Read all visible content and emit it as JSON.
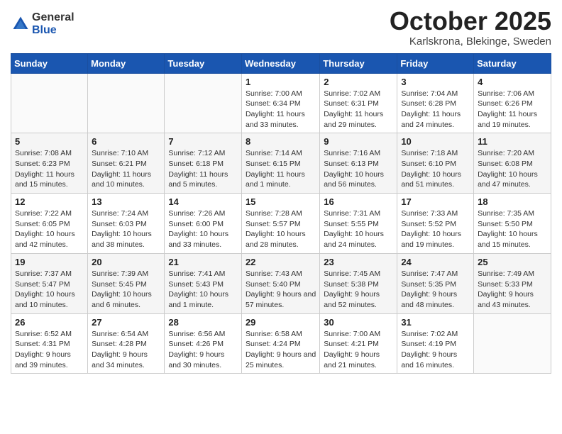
{
  "header": {
    "logo_general": "General",
    "logo_blue": "Blue",
    "month_title": "October 2025",
    "location": "Karlskrona, Blekinge, Sweden"
  },
  "days_of_week": [
    "Sunday",
    "Monday",
    "Tuesday",
    "Wednesday",
    "Thursday",
    "Friday",
    "Saturday"
  ],
  "weeks": [
    [
      {
        "day": "",
        "info": ""
      },
      {
        "day": "",
        "info": ""
      },
      {
        "day": "",
        "info": ""
      },
      {
        "day": "1",
        "info": "Sunrise: 7:00 AM\nSunset: 6:34 PM\nDaylight: 11 hours\nand 33 minutes."
      },
      {
        "day": "2",
        "info": "Sunrise: 7:02 AM\nSunset: 6:31 PM\nDaylight: 11 hours\nand 29 minutes."
      },
      {
        "day": "3",
        "info": "Sunrise: 7:04 AM\nSunset: 6:28 PM\nDaylight: 11 hours\nand 24 minutes."
      },
      {
        "day": "4",
        "info": "Sunrise: 7:06 AM\nSunset: 6:26 PM\nDaylight: 11 hours\nand 19 minutes."
      }
    ],
    [
      {
        "day": "5",
        "info": "Sunrise: 7:08 AM\nSunset: 6:23 PM\nDaylight: 11 hours\nand 15 minutes."
      },
      {
        "day": "6",
        "info": "Sunrise: 7:10 AM\nSunset: 6:21 PM\nDaylight: 11 hours\nand 10 minutes."
      },
      {
        "day": "7",
        "info": "Sunrise: 7:12 AM\nSunset: 6:18 PM\nDaylight: 11 hours\nand 5 minutes."
      },
      {
        "day": "8",
        "info": "Sunrise: 7:14 AM\nSunset: 6:15 PM\nDaylight: 11 hours\nand 1 minute."
      },
      {
        "day": "9",
        "info": "Sunrise: 7:16 AM\nSunset: 6:13 PM\nDaylight: 10 hours\nand 56 minutes."
      },
      {
        "day": "10",
        "info": "Sunrise: 7:18 AM\nSunset: 6:10 PM\nDaylight: 10 hours\nand 51 minutes."
      },
      {
        "day": "11",
        "info": "Sunrise: 7:20 AM\nSunset: 6:08 PM\nDaylight: 10 hours\nand 47 minutes."
      }
    ],
    [
      {
        "day": "12",
        "info": "Sunrise: 7:22 AM\nSunset: 6:05 PM\nDaylight: 10 hours\nand 42 minutes."
      },
      {
        "day": "13",
        "info": "Sunrise: 7:24 AM\nSunset: 6:03 PM\nDaylight: 10 hours\nand 38 minutes."
      },
      {
        "day": "14",
        "info": "Sunrise: 7:26 AM\nSunset: 6:00 PM\nDaylight: 10 hours\nand 33 minutes."
      },
      {
        "day": "15",
        "info": "Sunrise: 7:28 AM\nSunset: 5:57 PM\nDaylight: 10 hours\nand 28 minutes."
      },
      {
        "day": "16",
        "info": "Sunrise: 7:31 AM\nSunset: 5:55 PM\nDaylight: 10 hours\nand 24 minutes."
      },
      {
        "day": "17",
        "info": "Sunrise: 7:33 AM\nSunset: 5:52 PM\nDaylight: 10 hours\nand 19 minutes."
      },
      {
        "day": "18",
        "info": "Sunrise: 7:35 AM\nSunset: 5:50 PM\nDaylight: 10 hours\nand 15 minutes."
      }
    ],
    [
      {
        "day": "19",
        "info": "Sunrise: 7:37 AM\nSunset: 5:47 PM\nDaylight: 10 hours\nand 10 minutes."
      },
      {
        "day": "20",
        "info": "Sunrise: 7:39 AM\nSunset: 5:45 PM\nDaylight: 10 hours\nand 6 minutes."
      },
      {
        "day": "21",
        "info": "Sunrise: 7:41 AM\nSunset: 5:43 PM\nDaylight: 10 hours\nand 1 minute."
      },
      {
        "day": "22",
        "info": "Sunrise: 7:43 AM\nSunset: 5:40 PM\nDaylight: 9 hours\nand 57 minutes."
      },
      {
        "day": "23",
        "info": "Sunrise: 7:45 AM\nSunset: 5:38 PM\nDaylight: 9 hours\nand 52 minutes."
      },
      {
        "day": "24",
        "info": "Sunrise: 7:47 AM\nSunset: 5:35 PM\nDaylight: 9 hours\nand 48 minutes."
      },
      {
        "day": "25",
        "info": "Sunrise: 7:49 AM\nSunset: 5:33 PM\nDaylight: 9 hours\nand 43 minutes."
      }
    ],
    [
      {
        "day": "26",
        "info": "Sunrise: 6:52 AM\nSunset: 4:31 PM\nDaylight: 9 hours\nand 39 minutes."
      },
      {
        "day": "27",
        "info": "Sunrise: 6:54 AM\nSunset: 4:28 PM\nDaylight: 9 hours\nand 34 minutes."
      },
      {
        "day": "28",
        "info": "Sunrise: 6:56 AM\nSunset: 4:26 PM\nDaylight: 9 hours\nand 30 minutes."
      },
      {
        "day": "29",
        "info": "Sunrise: 6:58 AM\nSunset: 4:24 PM\nDaylight: 9 hours\nand 25 minutes."
      },
      {
        "day": "30",
        "info": "Sunrise: 7:00 AM\nSunset: 4:21 PM\nDaylight: 9 hours\nand 21 minutes."
      },
      {
        "day": "31",
        "info": "Sunrise: 7:02 AM\nSunset: 4:19 PM\nDaylight: 9 hours\nand 16 minutes."
      },
      {
        "day": "",
        "info": ""
      }
    ]
  ]
}
